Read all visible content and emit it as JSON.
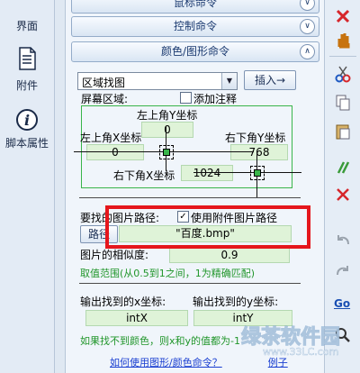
{
  "sidebar": {
    "items": [
      {
        "label": "界面"
      },
      {
        "label": "附件"
      },
      {
        "label": "脚本属性"
      }
    ]
  },
  "panel": {
    "headers": [
      {
        "label": "鼠标命令"
      },
      {
        "label": "控制命令"
      },
      {
        "label": "颜色/图形命令"
      }
    ],
    "command_select": "区域找图",
    "insert_button": "插入→",
    "screen_area_label": "屏幕区域:",
    "add_comment_label": "添加注释",
    "top_left_y_label": "左上角Y坐标",
    "top_left_y_value": "0",
    "top_left_x_label": "左上角X坐标",
    "top_left_x_value": "0",
    "bottom_right_y_label": "右下角Y坐标",
    "bottom_right_y_value": "768",
    "bottom_right_x_label": "右下角X坐标",
    "bottom_right_x_value": "1024",
    "image_path_label": "要找的图片路径:",
    "use_attachment_label": "使用附件图片路径",
    "path_button": "路径",
    "image_path_value": "\"百度.bmp\"",
    "similarity_label": "图片的相似度:",
    "similarity_value": "0.9",
    "similarity_hint": "取值范围(从0.5到1之间，1为精确匹配)",
    "out_x_label": "输出找到的x坐标:",
    "out_x_value": "intX",
    "out_y_label": "输出找到的y坐标:",
    "out_y_value": "intY",
    "not_found_hint": "如果找不到颜色，则x和y的值都为-1",
    "help_link": "如何使用图形/颜色命令？",
    "example_link": "例子"
  },
  "watermark": {
    "line1": "绿茶软件园",
    "line2": "www.33LC.com"
  },
  "colors": {
    "accent_green": "#39b54a",
    "highlight_red": "#e5161c",
    "link_blue": "#1a3fd1"
  }
}
